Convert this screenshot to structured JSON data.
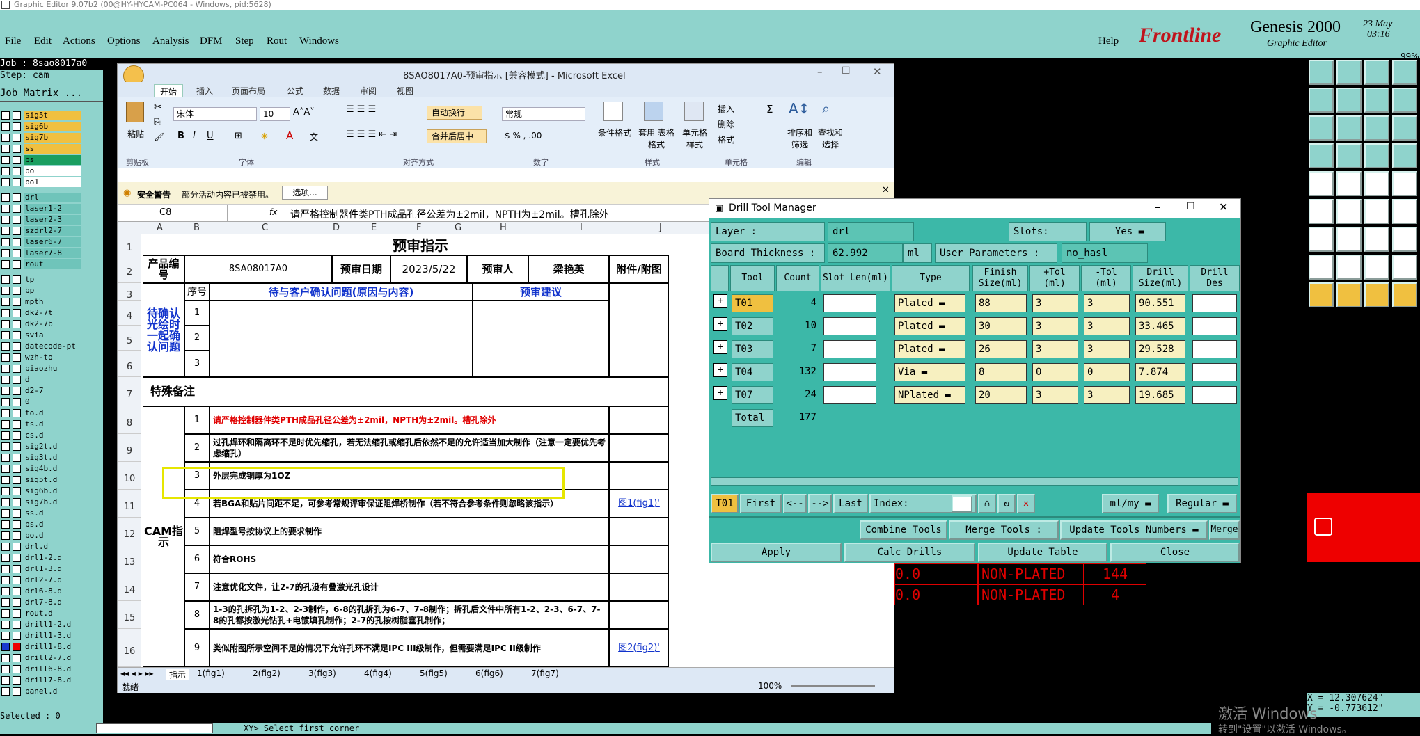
{
  "app": {
    "title": "Graphic Editor 9.07b2 (00@HY-HYCAM-PC064 - Windows, pid:5628)",
    "menu": [
      "File",
      "Edit",
      "Actions",
      "Options",
      "Analysis",
      "DFM",
      "Step",
      "Rout",
      "Windows"
    ],
    "help": "Help",
    "brand": "Frontline",
    "product": "Genesis 2000",
    "subtitle": "Graphic Editor",
    "date": "23 May",
    "time": "03:16",
    "zoom": "99%"
  },
  "job": {
    "job_label": "Job : 8sao8017a0",
    "step_label": "Step: cam",
    "matrix_btn": "Job Matrix ...",
    "selected": "Selected : 0"
  },
  "layers": [
    "sig5t",
    "sig6b",
    "sig7b",
    "ss",
    "bs",
    "bo",
    "bo1",
    "drl",
    "laser1-2",
    "laser2-3",
    "szdrl2-7",
    "laser6-7",
    "laser7-8",
    "rout",
    "tp",
    "bp",
    "mpth",
    "dk2-7t",
    "dk2-7b",
    "svia",
    "datecode-pt",
    "wzh-to",
    "biaozhu",
    "d",
    "d2-7",
    "0",
    "to.d",
    "ts.d",
    "cs.d",
    "sig2t.d",
    "sig3t.d",
    "sig4b.d",
    "sig5t.d",
    "sig6b.d",
    "sig7b.d",
    "ss.d",
    "bs.d",
    "bo.d",
    "drl.d",
    "drl1-2.d",
    "drl1-3.d",
    "drl2-7.d",
    "drl6-8.d",
    "drl7-8.d",
    "rout.d",
    "drill1-2.d",
    "drill1-3.d",
    "drill1-8.d",
    "drill2-7.d",
    "drill6-8.d",
    "drill7-8.d",
    "panel.d"
  ],
  "coords": {
    "x": "X = 12.307624\"",
    "y": "Y = -0.773612\""
  },
  "status_bar": {
    "prompt": "Select first corner"
  },
  "activation": {
    "line1": "激活 Windows",
    "line2": "转到\"设置\"以激活 Windows。"
  },
  "ncplated": [
    {
      "v": "0.0",
      "type": "NON-PLATED",
      "n": "144"
    },
    {
      "v": "0.0",
      "type": "NON-PLATED",
      "n": "4"
    }
  ],
  "excel": {
    "title": "8SAO8017A0-预审指示 [兼容模式] - Microsoft Excel",
    "tabs": [
      "开始",
      "插入",
      "页面布局",
      "公式",
      "数据",
      "审阅",
      "视图"
    ],
    "font_name": "宋体",
    "font_size": "10",
    "number_format": "常规",
    "paste": "粘贴",
    "wrap": "自动换行",
    "merge": "合并后居中",
    "cond_format": "条件格式",
    "table_format": "套用 表格格式",
    "cell_style": "单元格 样式",
    "insert": "插入",
    "delete": "删除",
    "format": "格式",
    "sort": "排序和 筛选",
    "find": "查找和 选择",
    "groups": [
      "剪贴板",
      "字体",
      "对齐方式",
      "数字",
      "样式",
      "单元格",
      "编辑"
    ],
    "security": "安全警告",
    "security_msg": "部分活动内容已被禁用。",
    "options": "选项...",
    "cell_ref": "C8",
    "formula": "请严格控制器件类PTH成品孔径公差为±2mil，NPTH为±2mil。槽孔除外",
    "cols": [
      "A",
      "B",
      "C",
      "D",
      "E",
      "F",
      "G",
      "H",
      "I",
      "J"
    ],
    "sheet_title": "预审指示",
    "r2": {
      "a": "产品编号",
      "b": "8SA08017A0",
      "c": "预审日期",
      "d": "2023/5/22",
      "e": "预审人",
      "f": "梁艳英",
      "g": "附件/附图"
    },
    "r3": {
      "seq": "序号",
      "q": "待与客户确认问题(原因与内容)",
      "s": "预审建议"
    },
    "side1": "待确认光绘时一起确认问题",
    "special": "特殊备注",
    "cam": "CAM指示",
    "items": [
      {
        "n": "1",
        "t": "请严格控制器件类PTH成品孔径公差为±2mil，NPTH为±2mil。槽孔除外",
        "a": ""
      },
      {
        "n": "2",
        "t": "过孔焊环和隔离环不足时优先缩孔，若无法缩孔或缩孔后依然不足的允许适当加大制作（注意一定要优先考虑缩孔）",
        "a": ""
      },
      {
        "n": "3",
        "t": "外层完成铜厚为1OZ",
        "a": ""
      },
      {
        "n": "4",
        "t": "若BGA和贴片间距不足，可参考常规评审保证阻焊桥制作（若不符合参考条件则忽略该指示）",
        "a": "图1(fig1)'"
      },
      {
        "n": "5",
        "t": "阻焊型号按协议上的要求制作",
        "a": ""
      },
      {
        "n": "6",
        "t": "符合ROHS",
        "a": ""
      },
      {
        "n": "7",
        "t": "注意优化文件，让2-7的孔没有叠激光孔设计",
        "a": ""
      },
      {
        "n": "8",
        "t": "1-3的孔拆孔为1-2、2-3制作，6-8的孔拆孔为6-7、7-8制作；拆孔后文件中所有1-2、2-3、6-7、7-8的孔都按激光钻孔+电镀填孔制作；2-7的孔按树脂塞孔制作；",
        "a": ""
      },
      {
        "n": "9",
        "t": "类似附图所示空间不足的情况下允许孔环不满足IPC III级制作，但需要满足IPC II级制作",
        "a": "图2(fig2)'"
      }
    ],
    "sheets": [
      "指示",
      "1(fig1)",
      "2(fig2)",
      "3(fig3)",
      "4(fig4)",
      "5(fig5)",
      "6(fig6)",
      "7(fig7)"
    ],
    "status": "就绪",
    "zoom": "100%"
  },
  "drill": {
    "title": "Drill Tool Manager",
    "layer_lbl": "Layer",
    "layer": "drl",
    "slots_lbl": "Slots:",
    "slots": "Yes",
    "thick_lbl": "Board Thickness :",
    "thick": "62.992",
    "unit": "ml",
    "up_lbl": "User Parameters :",
    "up": "no_hasl",
    "headers": [
      "Tool",
      "Count",
      "Slot Len(ml)",
      "Type",
      "Finish Size(ml)",
      "+Tol (ml)",
      "-Tol (ml)",
      "Drill Size(ml)",
      "Drill Des"
    ],
    "rows": [
      {
        "tool": "T01",
        "count": "4",
        "type": "Plated",
        "finish": "88",
        "ptol": "3",
        "ntol": "3",
        "drill": "90.551"
      },
      {
        "tool": "T02",
        "count": "10",
        "type": "Plated",
        "finish": "30",
        "ptol": "3",
        "ntol": "3",
        "drill": "33.465"
      },
      {
        "tool": "T03",
        "count": "7",
        "type": "Plated",
        "finish": "26",
        "ptol": "3",
        "ntol": "3",
        "drill": "29.528"
      },
      {
        "tool": "T04",
        "count": "132",
        "type": "Via",
        "finish": "8",
        "ptol": "0",
        "ntol": "0",
        "drill": "7.874"
      },
      {
        "tool": "T07",
        "count": "24",
        "type": "NPlated",
        "finish": "20",
        "ptol": "3",
        "ntol": "3",
        "drill": "19.685"
      }
    ],
    "total_lbl": "Total",
    "total": "177",
    "cur": "T01",
    "first": "First",
    "prev": "<--",
    "next": "-->",
    "last": "Last",
    "index": "Index:",
    "units": "ml/my",
    "mode": "Regular",
    "combine": "Combine Tools",
    "merge_lbl": "Merge Tools :",
    "update_nums": "Update Tools Numbers",
    "merge": "Merge",
    "apply": "Apply",
    "calc": "Calc Drills",
    "update_table": "Update Table",
    "close": "Close"
  }
}
